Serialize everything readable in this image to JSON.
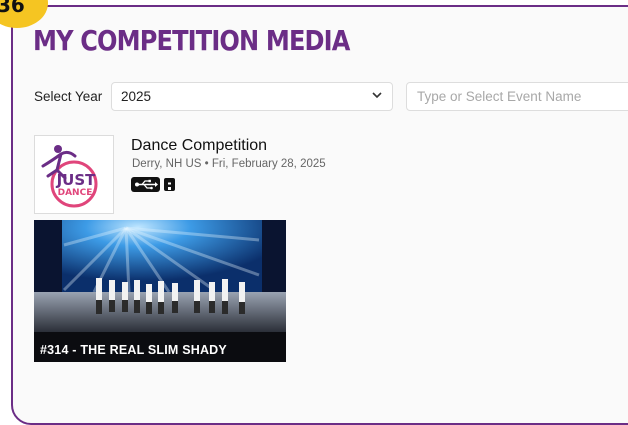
{
  "step_badge": {
    "number": "36",
    "color": "#f5c522"
  },
  "page_title": "MY COMPETITION MEDIA",
  "accent_color": "#6b2d86",
  "filters": {
    "year_label": "Select Year",
    "year_value": "2025",
    "event_placeholder": "Type or Select Event Name"
  },
  "event": {
    "title": "Dance Competition",
    "location": "Derry, NH US",
    "separator": "•",
    "date": "Fri, February 28, 2025",
    "logo": {
      "line1": "JUST",
      "line2": "DANCE"
    },
    "media_icons": [
      "usb-drive-icon",
      "storage-device-icon"
    ]
  },
  "video": {
    "caption": "#314 - THE REAL SLIM SHADY"
  }
}
